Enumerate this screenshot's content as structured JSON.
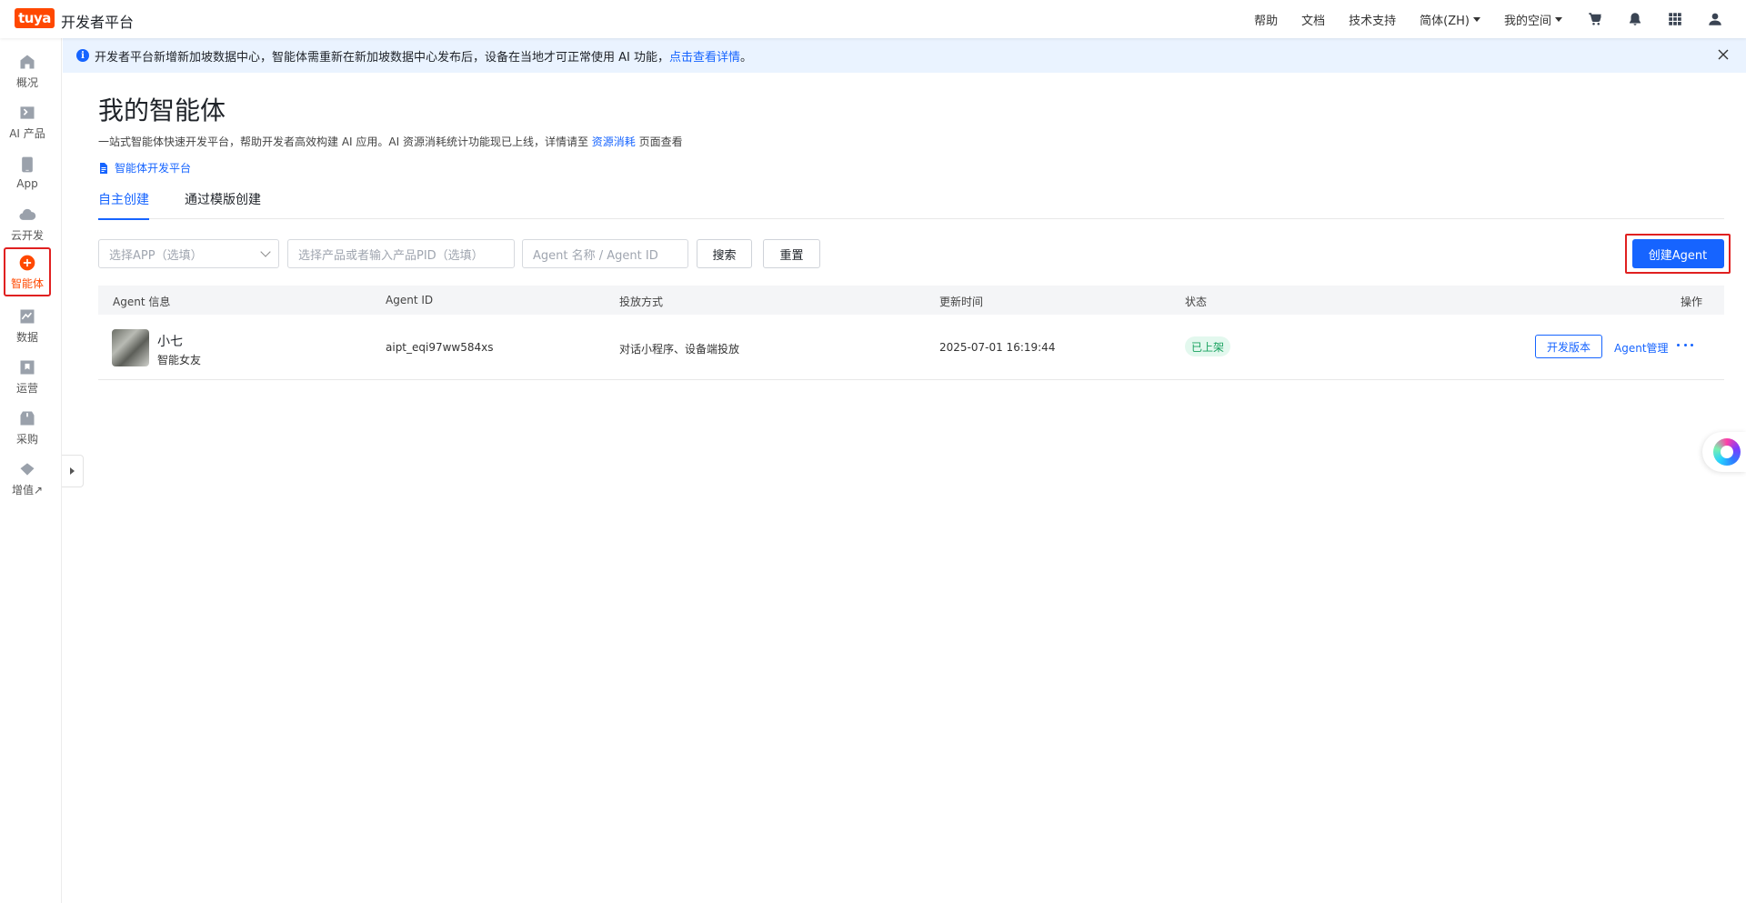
{
  "header": {
    "logo_text": "tuya",
    "brand": "开发者平台",
    "nav": [
      "帮助",
      "文档",
      "技术支持"
    ],
    "language": "简体(ZH)",
    "workspace": "我的空间",
    "icons": [
      "cart-icon",
      "bell-icon",
      "apps-grid-icon",
      "user-icon"
    ]
  },
  "sidebar": {
    "items": [
      {
        "label": "概况",
        "icon": "home-icon"
      },
      {
        "label": "AI 产品",
        "icon": "terminal-icon"
      },
      {
        "label": "App",
        "icon": "phone-icon"
      },
      {
        "label": "云开发",
        "icon": "cloud-icon"
      },
      {
        "label": "智能体",
        "icon": "plus-circle-icon",
        "active": true
      },
      {
        "label": "数据",
        "icon": "chart-icon"
      },
      {
        "label": "运营",
        "icon": "bookmark-icon"
      },
      {
        "label": "采购",
        "icon": "package-icon"
      },
      {
        "label": "增值↗",
        "icon": "diamond-icon"
      }
    ]
  },
  "notice": {
    "text": "开发者平台新增新加坡数据中心，智能体需重新在新加坡数据中心发布后，设备在当地才可正常使用 AI 功能，",
    "link": "点击查看详情",
    "end": "。"
  },
  "page": {
    "title": "我的智能体",
    "subtitle_before": "一站式智能体快速开发平台，帮助开发者高效构建 AI 应用。AI 资源消耗统计功能现已上线，详情请至 ",
    "subtitle_link": "资源消耗",
    "subtitle_after": " 页面查看",
    "doc_link": "智能体开发平台",
    "tabs": [
      "自主创建",
      "通过模版创建"
    ]
  },
  "filters": {
    "app_placeholder": "选择APP（选填）",
    "product_placeholder": "选择产品或者输入产品PID（选填）",
    "agent_placeholder": "Agent 名称 / Agent ID",
    "search_label": "搜索",
    "reset_label": "重置",
    "create_label": "创建Agent"
  },
  "table": {
    "headers": [
      "Agent 信息",
      "Agent ID",
      "投放方式",
      "更新时间",
      "状态",
      "操作"
    ],
    "rows": [
      {
        "name": "小七",
        "tag": "智能女友",
        "agent_id": "aipt_eqi97ww584xs",
        "delivery": "对话小程序、设备端投放",
        "updated": "2025-07-01 16:19:44",
        "status": "已上架",
        "action_dev": "开发版本",
        "action_manage": "Agent管理"
      }
    ]
  },
  "colors": {
    "accent": "#1664ff",
    "brand": "#ff4800",
    "highlight_border": "#e02020",
    "status_green": "#1aa260"
  }
}
